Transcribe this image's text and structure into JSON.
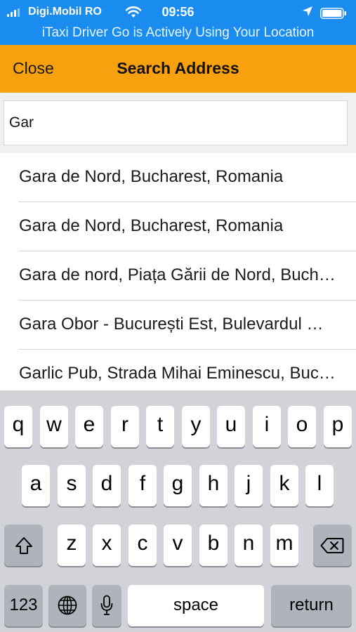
{
  "status_bar": {
    "carrier": "Digi.Mobil RO",
    "time": "09:56",
    "location_banner": "iTaxi Driver Go is Actively Using Your Location",
    "icons": [
      "signal-icon",
      "wifi-icon",
      "location-arrow-icon",
      "battery-icon"
    ]
  },
  "nav": {
    "close_label": "Close",
    "title": "Search Address"
  },
  "search": {
    "value": "Gar"
  },
  "results": [
    "Gara de Nord, Bucharest, Romania",
    "Gara de Nord, Bucharest, Romania",
    "Gara de nord, Piața Gării de Nord, Bucharest, Romania",
    "Gara Obor - București Est, Bulevardul Gării Obor, Bucharest",
    "Garlic Pub, Strada Mihai Eminescu, Bucharest"
  ],
  "keyboard": {
    "row1": [
      "q",
      "w",
      "e",
      "r",
      "t",
      "y",
      "u",
      "i",
      "o",
      "p"
    ],
    "row2": [
      "a",
      "s",
      "d",
      "f",
      "g",
      "h",
      "j",
      "k",
      "l"
    ],
    "row3": [
      "z",
      "x",
      "c",
      "v",
      "b",
      "n",
      "m"
    ],
    "numbers_label": "123",
    "space_label": "space",
    "return_label": "return",
    "icons": [
      "shift-icon",
      "backspace-icon",
      "globe-icon",
      "microphone-icon"
    ]
  },
  "colors": {
    "status_bar": "#1a8cf0",
    "nav_bar": "#f7a10f",
    "keyboard_bg": "#d1d3d9"
  }
}
